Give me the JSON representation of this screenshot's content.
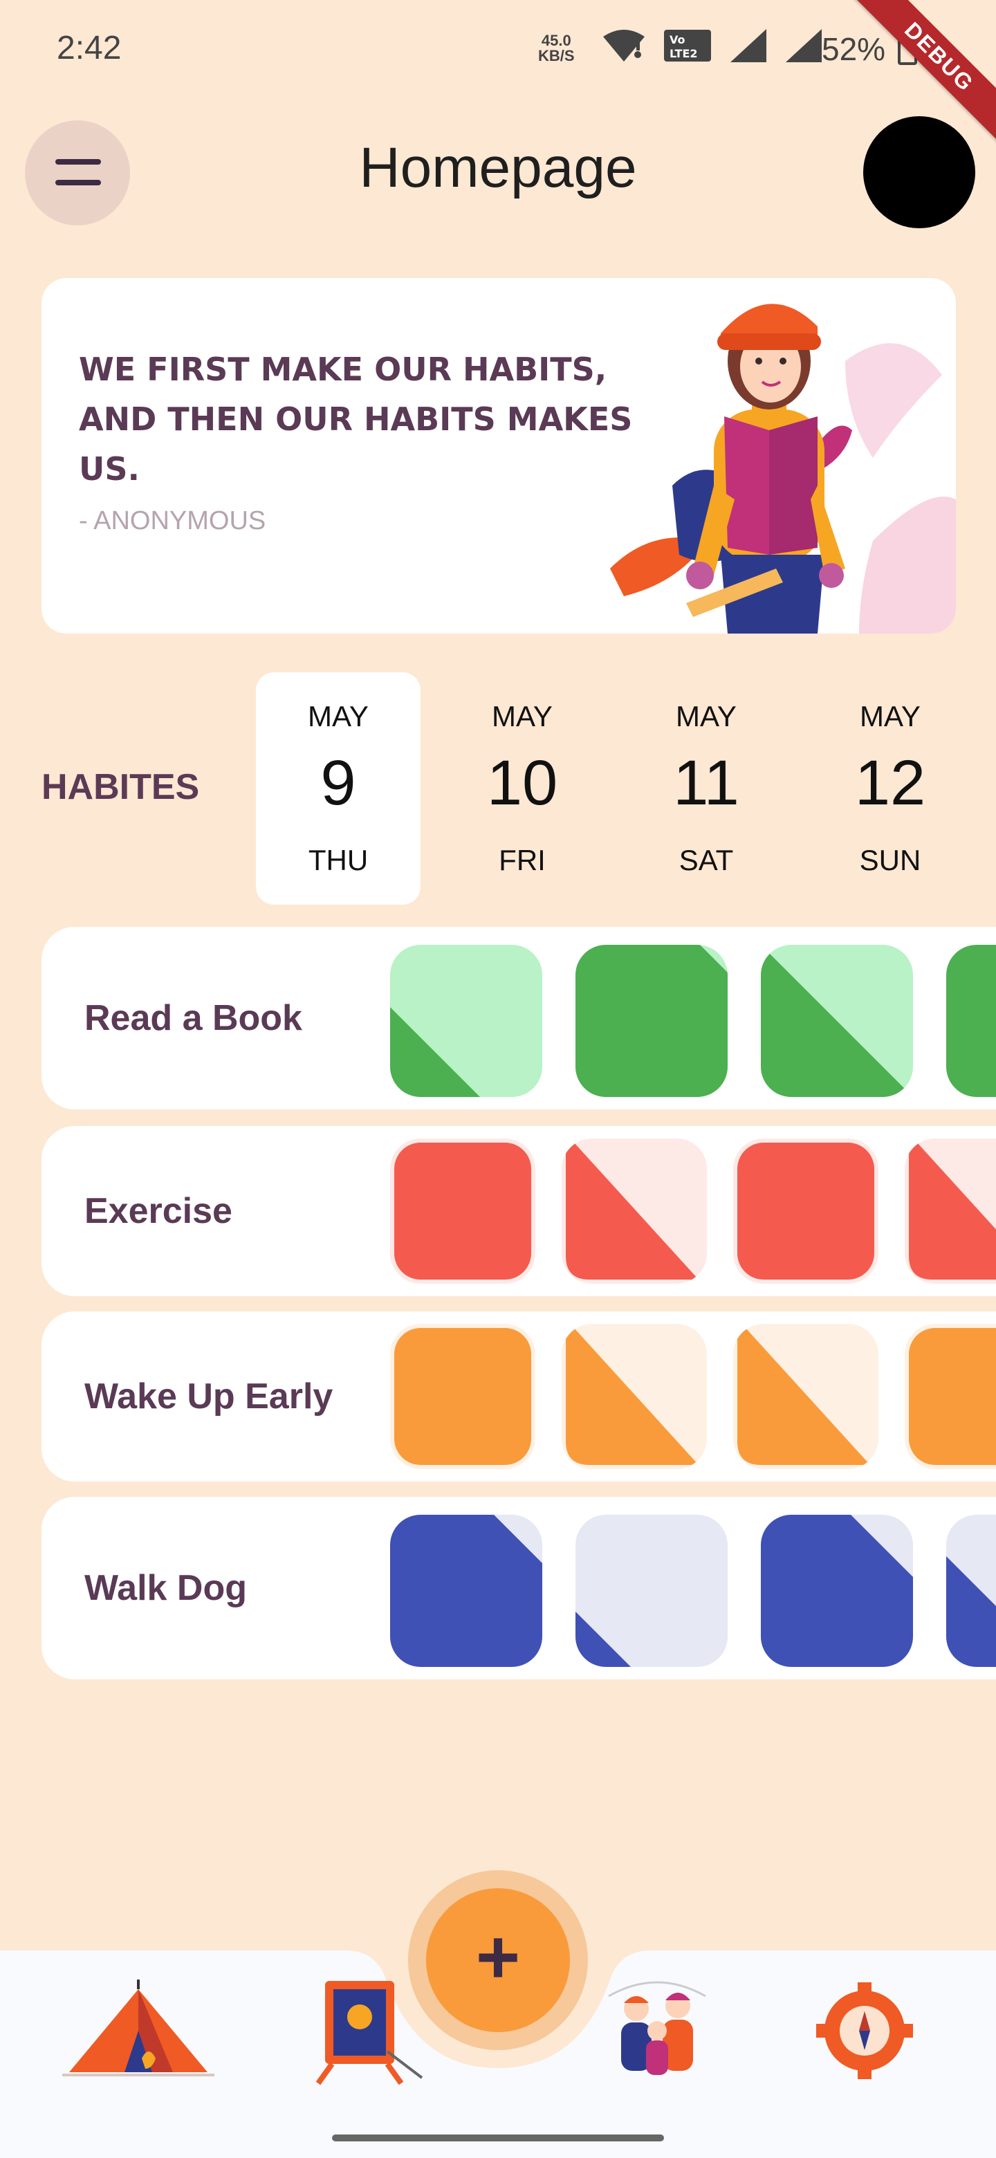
{
  "status_bar": {
    "time": "2:42",
    "net_speed_value": "45.0",
    "net_speed_unit": "KB/S",
    "battery": "52%",
    "debug_banner": "DEBUG"
  },
  "header": {
    "title": "Homepage"
  },
  "quote": {
    "text": "We first make our habits, and then our habits makes us.",
    "author": "- ANONYMOUS"
  },
  "habits_label": "HABITES",
  "dates": [
    {
      "month": "MAY",
      "day": "9",
      "weekday": "THU"
    },
    {
      "month": "MAY",
      "day": "10",
      "weekday": "FRI"
    },
    {
      "month": "MAY",
      "day": "11",
      "weekday": "SAT"
    },
    {
      "month": "MAY",
      "day": "12",
      "weekday": "SUN"
    }
  ],
  "habits": [
    {
      "name": "Read a Book",
      "color": "#4CAF50",
      "light": "#B8F2C6"
    },
    {
      "name": "Exercise",
      "color": "#F45B4E",
      "light": "#FDE9E6"
    },
    {
      "name": "Wake Up Early",
      "color": "#F99B3B",
      "light": "#FEF1E4"
    },
    {
      "name": "Walk Dog",
      "color": "#3F51B5",
      "light": "#E6E8F3"
    }
  ],
  "colors": {
    "background": "#FDE8D3",
    "accent": "#F99B3B",
    "text_primary": "#5a3a55",
    "nav_background": "#F8FAFE"
  },
  "bottom_nav": {
    "items": [
      "tent-icon",
      "easel-icon",
      "people-icon",
      "compass-gear-icon"
    ],
    "fab_symbol": "+"
  }
}
